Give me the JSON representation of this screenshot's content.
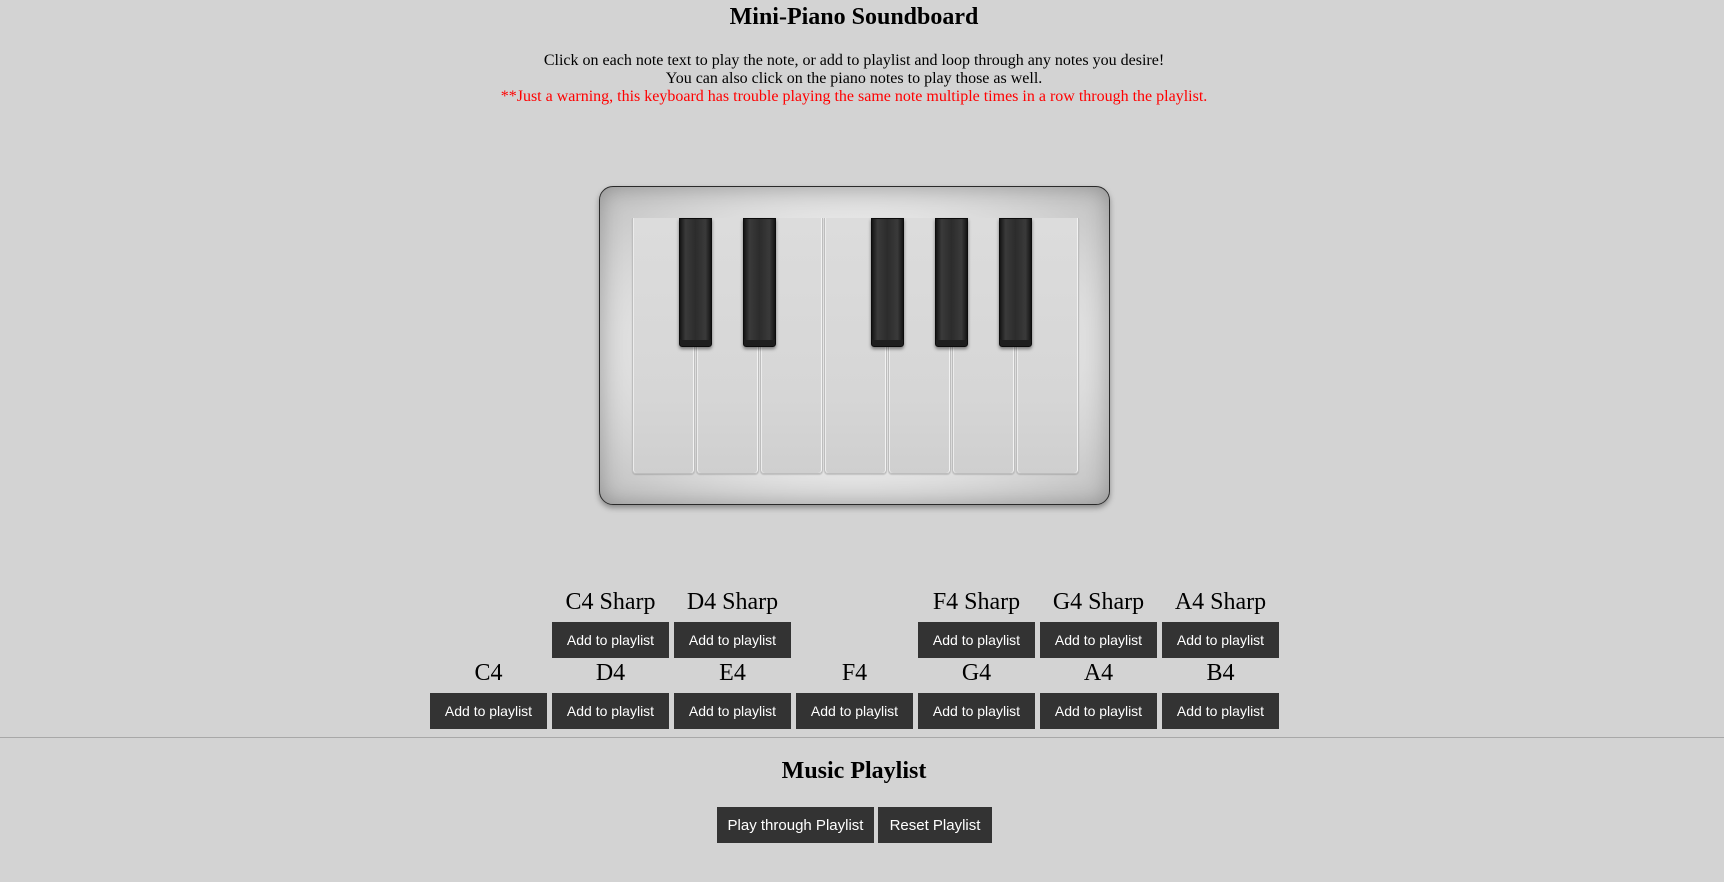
{
  "header": {
    "title": "Mini-Piano Soundboard",
    "line1": "Click on each note text to play the note, or add to playlist and loop through any notes you desire!",
    "line2": "You can also click on the piano notes to play those as well.",
    "warning": "**Just a warning, this keyboard has trouble playing the same note multiple times in a row through the playlist."
  },
  "colors": {
    "background": "#d3d3d3",
    "button": "#333333",
    "warning": "#ff0000"
  },
  "notes": {
    "sharps": [
      {
        "label": "C4 Sharp",
        "button": "Add to playlist"
      },
      {
        "label": "D4 Sharp",
        "button": "Add to playlist"
      },
      {
        "label": "F4 Sharp",
        "button": "Add to playlist"
      },
      {
        "label": "G4 Sharp",
        "button": "Add to playlist"
      },
      {
        "label": "A4 Sharp",
        "button": "Add to playlist"
      }
    ],
    "naturals": [
      {
        "label": "C4",
        "button": "Add to playlist"
      },
      {
        "label": "D4",
        "button": "Add to playlist"
      },
      {
        "label": "E4",
        "button": "Add to playlist"
      },
      {
        "label": "F4",
        "button": "Add to playlist"
      },
      {
        "label": "G4",
        "button": "Add to playlist"
      },
      {
        "label": "A4",
        "button": "Add to playlist"
      },
      {
        "label": "B4",
        "button": "Add to playlist"
      }
    ]
  },
  "playlist": {
    "title": "Music Playlist",
    "play_label": "Play through Playlist",
    "reset_label": "Reset Playlist"
  }
}
